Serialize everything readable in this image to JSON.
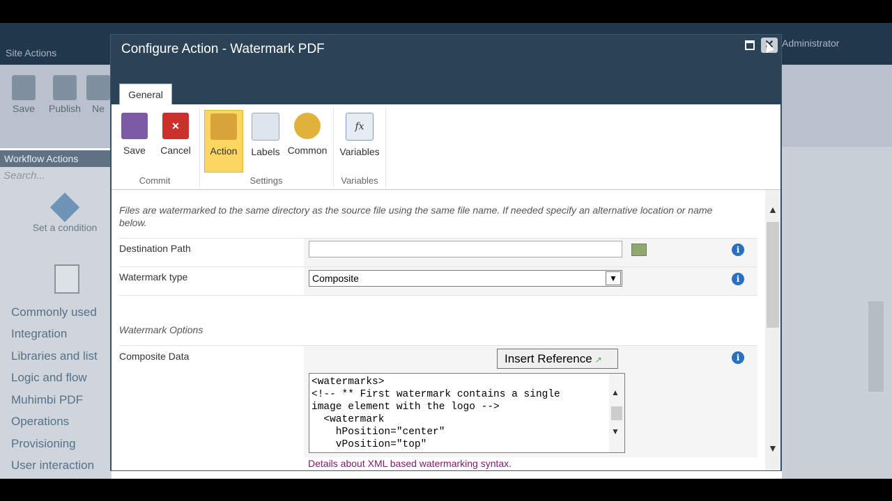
{
  "background": {
    "site_actions": "Site Actions",
    "user": "Administrator",
    "ribbon_buttons": [
      {
        "label": "Save"
      },
      {
        "label": "Publish"
      },
      {
        "label": "Ne"
      }
    ],
    "sidebar": {
      "heading": "Workflow Actions",
      "search_placeholder": "Search...",
      "condition_label": "Set a condition",
      "categories": [
        "Commonly used",
        "Integration",
        "Libraries and list",
        "Logic and flow",
        "Muhimbi PDF",
        "Operations",
        "Provisioning",
        "User interaction"
      ]
    }
  },
  "dialog": {
    "title": "Configure Action - Watermark PDF",
    "tab": "General",
    "ribbon": {
      "buttons": [
        {
          "label": "Save",
          "icon": "floppy-disk-icon"
        },
        {
          "label": "Cancel",
          "icon": "red-x-icon"
        },
        {
          "label": "Action",
          "icon": "gears-action-icon"
        },
        {
          "label": "Labels",
          "icon": "labels-doc-icon"
        },
        {
          "label": "Common",
          "icon": "gear-icon"
        },
        {
          "label": "Variables",
          "icon": "fx-variables-icon"
        }
      ],
      "groups": [
        "Commit",
        "Settings",
        "Variables"
      ]
    },
    "form": {
      "intro": "Files are watermarked to the same directory as the source file using the same file name. If needed specify an alternative location or name below.",
      "destination_label": "Destination Path",
      "destination_value": "",
      "watermark_type_label": "Watermark type",
      "watermark_type_value": "Composite",
      "section_title": "Watermark Options",
      "composite_label": "Composite Data",
      "insert_reference": "Insert Reference",
      "composite_value": "<watermarks>\n<!-- ** First watermark contains a single\nimage element with the logo -->\n  <watermark\n    hPosition=\"center\"\n    vPosition=\"top\"",
      "details_link": "Details about XML based watermarking syntax."
    }
  },
  "colors": {
    "title_bar": "#2c4257",
    "active_button": "#fbd660",
    "link": "#7a1c6b",
    "info_icon": "#2a6fc2"
  }
}
